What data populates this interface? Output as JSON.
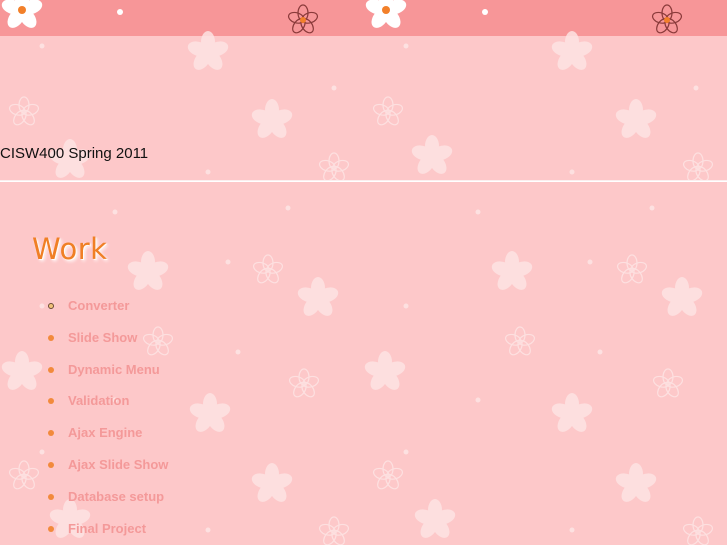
{
  "site": {
    "title": "CISW400 Spring 2011"
  },
  "section": {
    "heading": "Work"
  },
  "work_items": [
    {
      "label": "Converter"
    },
    {
      "label": "Slide Show"
    },
    {
      "label": "Dynamic Menu"
    },
    {
      "label": "Validation"
    },
    {
      "label": "Ajax Engine"
    },
    {
      "label": "Ajax Slide Show"
    },
    {
      "label": "Database setup"
    },
    {
      "label": "Final Project"
    }
  ],
  "colors": {
    "background": "#fdc8c9",
    "top_band": "#f79698",
    "heading": "#f07f25",
    "link": "#f49999",
    "bullet": "#f28a3c"
  }
}
